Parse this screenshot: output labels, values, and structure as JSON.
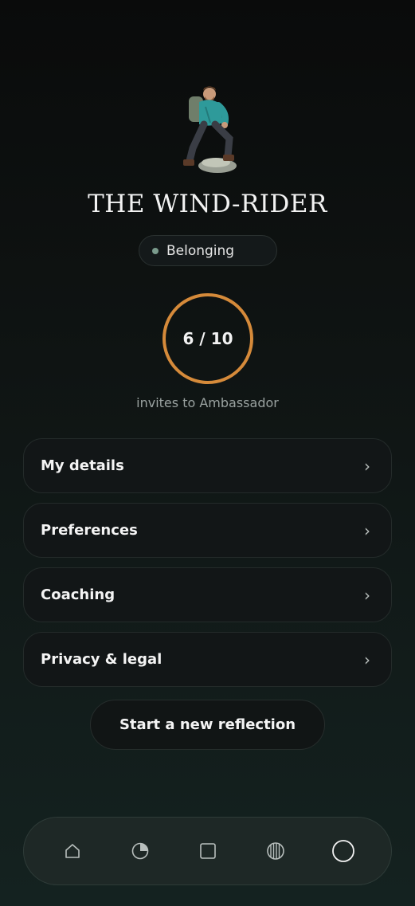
{
  "profile": {
    "title": "THE WIND-RIDER",
    "status": "Belonging",
    "status_dot_color": "#7a9a8c",
    "avatar_icon": "hiker-avatar"
  },
  "progress": {
    "text": "6 / 10",
    "current": 6,
    "total": 10,
    "caption": "invites to Ambassador",
    "ring_color": "#D58A3A"
  },
  "menu": {
    "items": [
      {
        "label": "My details",
        "icon": "chevron-right-icon"
      },
      {
        "label": "Preferences",
        "icon": "chevron-right-icon"
      },
      {
        "label": "Coaching",
        "icon": "chevron-right-icon"
      },
      {
        "label": "Privacy & legal",
        "icon": "chevron-right-icon"
      }
    ],
    "chevron": "›"
  },
  "actions": {
    "reflection_label": "Start a new reflection"
  },
  "nav": {
    "items": [
      "home-icon",
      "pie-chart-icon",
      "square-icon",
      "striped-circle-icon",
      "profile-circle-icon"
    ],
    "active": "profile-circle-icon"
  }
}
